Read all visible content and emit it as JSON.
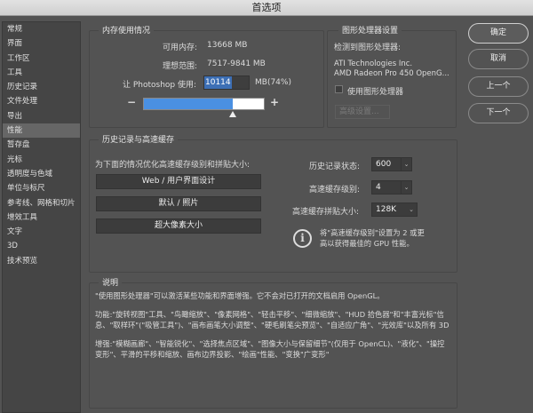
{
  "window": {
    "title": "首选项"
  },
  "sidebar": {
    "items": [
      "常规",
      "界面",
      "工作区",
      "工具",
      "历史记录",
      "文件处理",
      "导出",
      "性能",
      "暂存盘",
      "光标",
      "透明度与色域",
      "单位与标尺",
      "参考线、网格和切片",
      "增效工具",
      "文字",
      "3D",
      "技术预览"
    ],
    "selected": "性能"
  },
  "memory": {
    "title": "内存使用情况",
    "available_label": "可用内存:",
    "available_value": "13668 MB",
    "ideal_label": "理想范围:",
    "ideal_value": "7517-9841 MB",
    "use_label": "让 Photoshop 使用:",
    "use_value": "10114",
    "use_unit": "MB(74%)",
    "minus": "−",
    "plus": "+",
    "slider_percent": 74
  },
  "gpu": {
    "title": "图形处理器设置",
    "detected_label": "检测到图形处理器:",
    "vendor": "ATI Technologies Inc.",
    "model": "AMD Radeon Pro 450 OpenG...",
    "use_gpu_label": "使用图形处理器",
    "use_gpu_checked": false,
    "advanced_label": "高级设置..."
  },
  "buttons": {
    "ok": "确定",
    "cancel": "取消",
    "prev": "上一个",
    "next": "下一个"
  },
  "history": {
    "title": "历史记录与高速缓存",
    "optimize_label": "为下面的情况优化高速缓存级别和拼贴大小:",
    "presets": [
      "Web / 用户界面设计",
      "默认 / 照片",
      "超大像素大小"
    ],
    "states_label": "历史记录状态:",
    "states_value": "600",
    "cache_levels_label": "高速缓存级别:",
    "cache_levels_value": "4",
    "tile_size_label": "高速缓存拼贴大小:",
    "tile_size_value": "128K",
    "info": "将\"高速缓存级别\"设置为 2 或更高以获得最佳的 GPU 性能。"
  },
  "description": {
    "title": "说明",
    "paragraphs": [
      "\"使用图形处理器\"可以激活某些功能和界面增强。它不会对已打开的文档启用 OpenGL。",
      "功能:\"旋转视图\"工具、\"鸟瞰缩放\"、\"像素网格\"、\"轻击平移\"、\"细微缩放\"、\"HUD 拾色器\"和\"丰富光标\"信息、\"取样环\"(\"吸管工具\")、\"画布画笔大小调整\"、\"硬毛刷笔尖预览\"、\"自适应广角\"、\"光效库\"以及所有 3D",
      "增强:\"模糊画廊\"、\"智能锐化\"、\"选择焦点区域\"、\"图像大小与保留细节\"(仅用于 OpenCL)、\"液化\"、\"操控变形\"、平滑的平移和缩放、画布边界投影、\"绘画\"性能、\"变换\"广变形\""
    ]
  },
  "colors": {
    "accent": "#4a90e2",
    "background": "#535353"
  }
}
